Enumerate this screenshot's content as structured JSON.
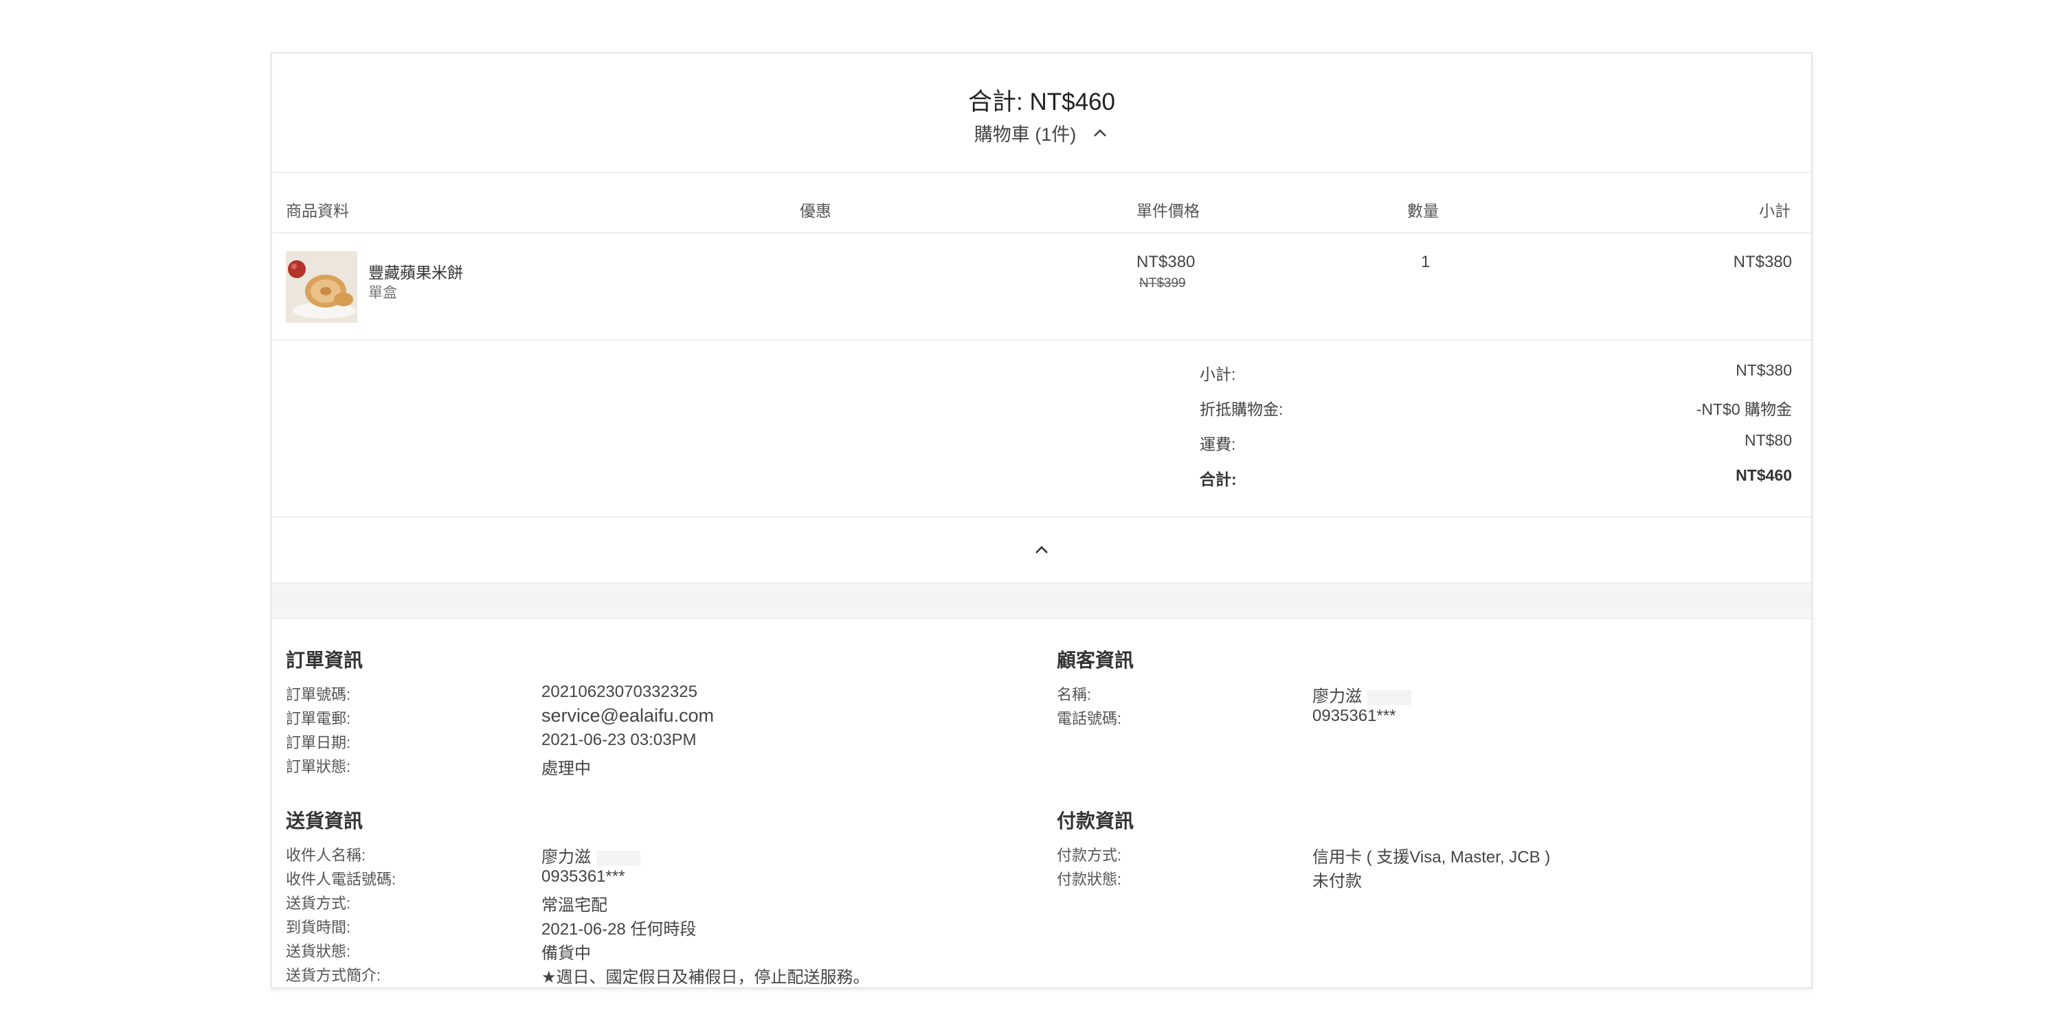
{
  "summary": {
    "total_title": "合計: NT$460",
    "cart_label": "購物車 (1件)"
  },
  "table": {
    "headers": {
      "product": "商品資料",
      "discount": "優惠",
      "unit_price": "單件價格",
      "quantity": "數量",
      "subtotal": "小計"
    },
    "items": [
      {
        "name": "豐藏蘋果米餅",
        "variant": "單盒",
        "price": "NT$380",
        "original_price": "NT$399",
        "quantity": "1",
        "subtotal": "NT$380"
      }
    ]
  },
  "totals": {
    "subtotal_label": "小計:",
    "subtotal_value": "NT$380",
    "credit_label": "折抵購物金:",
    "credit_value": "-NT$0 購物金",
    "shipping_label": "運費:",
    "shipping_value": "NT$80",
    "total_label": "合計:",
    "total_value": "NT$460"
  },
  "order_info": {
    "title": "訂單資訊",
    "rows": [
      {
        "k": "訂單號碼:",
        "v": "20210623070332325"
      },
      {
        "k": "訂單電郵:",
        "v": "service@ealaifu.com"
      },
      {
        "k": "訂單日期:",
        "v": "2021-06-23 03:03PM"
      },
      {
        "k": "訂單狀態:",
        "v": "處理中"
      }
    ]
  },
  "customer_info": {
    "title": "顧客資訊",
    "rows": [
      {
        "k": "名稱:",
        "v": "廖力滋"
      },
      {
        "k": "電話號碼:",
        "v": "0935361***"
      }
    ]
  },
  "delivery_info": {
    "title": "送貨資訊",
    "rows": [
      {
        "k": "收件人名稱:",
        "v": "廖力滋"
      },
      {
        "k": "收件人電話號碼:",
        "v": "0935361***"
      },
      {
        "k": "送貨方式:",
        "v": "常溫宅配"
      },
      {
        "k": "到貨時間:",
        "v": "2021-06-28 任何時段"
      },
      {
        "k": "送貨狀態:",
        "v": "備貨中"
      },
      {
        "k": "送貨方式簡介:",
        "v": "★週日、國定假日及補假日，停止配送服務。"
      }
    ]
  },
  "payment_info": {
    "title": "付款資訊",
    "rows": [
      {
        "k": "付款方式:",
        "v": "信用卡 ( 支援Visa, Master, JCB )"
      },
      {
        "k": "付款狀態:",
        "v": "未付款"
      }
    ]
  },
  "icons": {
    "cart_toggle": "chevron-up-icon",
    "collapse": "chevron-up-icon"
  }
}
